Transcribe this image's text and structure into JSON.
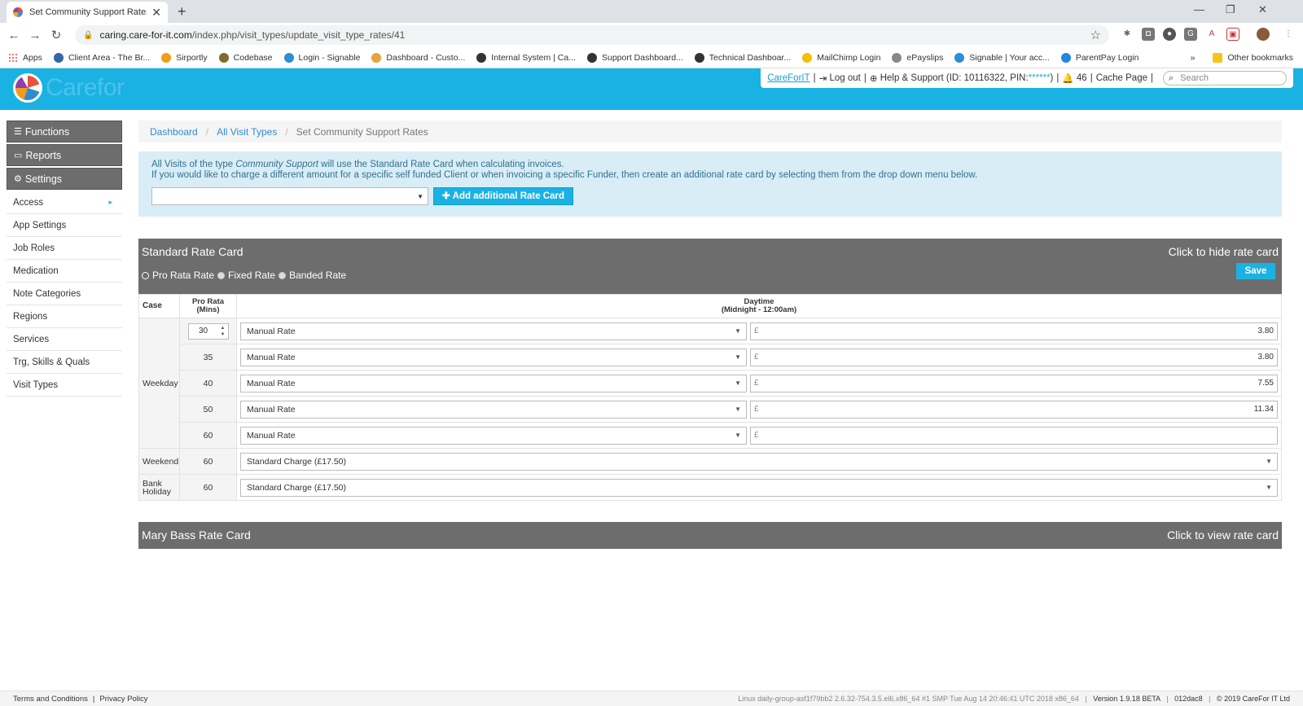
{
  "browser": {
    "tab_title": "Set Community Support Rates | C",
    "tab_close": "✕",
    "new_tab": "+",
    "url_host": "caring.care-for-it.com",
    "url_path": "/index.php/visit_types/update_visit_type_rates/41",
    "bookmarks": [
      {
        "label": "Apps",
        "color": "#e74c3c"
      },
      {
        "label": "Client Area - The Br...",
        "color": "#3465a4"
      },
      {
        "label": "Sirportly",
        "color": "#f39c12"
      },
      {
        "label": "Codebase",
        "color": "#7f6b2c"
      },
      {
        "label": "Login - Signable",
        "color": "#2d8fd5"
      },
      {
        "label": "Dashboard - Custo...",
        "color": "#e8a33d"
      },
      {
        "label": "Internal System | Ca...",
        "color": "#333333"
      },
      {
        "label": "Support Dashboard...",
        "color": "#333333"
      },
      {
        "label": "Technical Dashboar...",
        "color": "#333333"
      },
      {
        "label": "MailChimp Login",
        "color": "#f2c100"
      },
      {
        "label": "ePayslips",
        "color": "#888888"
      },
      {
        "label": "Signable | Your acc...",
        "color": "#2d8fd5"
      },
      {
        "label": "ParentPay Login",
        "color": "#1e88e5"
      }
    ],
    "bookmarks_more": "»",
    "other_bookmarks": "Other bookmarks"
  },
  "header": {
    "logo_text": "Carefor",
    "user_link": "CareForIT",
    "logout": "Log out",
    "help_prefix": "Help & Support (ID: 10116322, PIN:",
    "pin": "******",
    "help_suffix": ")",
    "alerts": "46",
    "cache": "Cache Page",
    "search_placeholder": "Search",
    "accent_color": "#1ab2e3"
  },
  "sidebar": {
    "buttons": [
      {
        "label": "Functions",
        "icon": "list-icon"
      },
      {
        "label": "Reports",
        "icon": "folder-icon"
      },
      {
        "label": "Settings",
        "icon": "gear-icon"
      }
    ],
    "items": [
      {
        "label": "Access",
        "chevron": "▸"
      },
      {
        "label": "App Settings"
      },
      {
        "label": "Job Roles"
      },
      {
        "label": "Medication"
      },
      {
        "label": "Note Categories"
      },
      {
        "label": "Regions"
      },
      {
        "label": "Services"
      },
      {
        "label": "Trg, Skills & Quals"
      },
      {
        "label": "Visit Types"
      }
    ]
  },
  "breadcrumb": {
    "items": [
      "Dashboard",
      "All Visit Types"
    ],
    "current": "Set Community Support Rates",
    "separator": "/"
  },
  "info": {
    "line1_prefix": "All Visits of the type ",
    "line1_type": "Community Support",
    "line1_suffix": " will use the Standard Rate Card when calculating invoices.",
    "line2": "If you would like to charge a different amount for a specific self funded Client or when invoicing a specific Funder, then create an additional rate card by selecting them from the drop down menu below.",
    "add_button": "Add additional Rate Card"
  },
  "standard_card": {
    "title": "Standard Rate Card",
    "toggle": "Click to hide rate card",
    "save": "Save",
    "radio_options": [
      "Pro Rata Rate",
      "Fixed Rate",
      "Banded Rate"
    ],
    "selected_option": "Pro Rata Rate",
    "columns": {
      "case": "Case",
      "pro_rata_1": "Pro Rata",
      "pro_rata_2": "(Mins)",
      "daytime_1": "Daytime",
      "daytime_2": "(Midnight - 12:00am)"
    },
    "weekday_label": "Weekday",
    "weekday_rows": [
      {
        "mins": "30",
        "rate_type": "Manual Rate",
        "currency": "£",
        "amount": "3.80"
      },
      {
        "mins": "35",
        "rate_type": "Manual Rate",
        "currency": "£",
        "amount": "3.80"
      },
      {
        "mins": "40",
        "rate_type": "Manual Rate",
        "currency": "£",
        "amount": "7.55"
      },
      {
        "mins": "50",
        "rate_type": "Manual Rate",
        "currency": "£",
        "amount": "11.34"
      },
      {
        "mins": "60",
        "rate_type": "Manual Rate",
        "currency": "£",
        "amount": ""
      }
    ],
    "weekend": {
      "label": "Weekend",
      "mins": "60",
      "rate_type": "Standard Charge (£17.50)"
    },
    "bank_holiday": {
      "label_1": "Bank",
      "label_2": "Holiday",
      "mins": "60",
      "rate_type": "Standard Charge (£17.50)"
    }
  },
  "second_card": {
    "title": "Mary Bass Rate Card",
    "toggle": "Click to view rate card"
  },
  "footer": {
    "terms": "Terms and Conditions",
    "sep": "|",
    "privacy": "Privacy Policy",
    "server": "Linux daily-group-asf1f79bb2 2.6.32-754.3.5.el6.x86_64 #1 SMP Tue Aug 14 20:46:41 UTC 2018 x86_64",
    "version": "Version 1.9.18 BETA",
    "build": "012dac8",
    "copyright": "© 2019 CareFor IT Ltd"
  }
}
